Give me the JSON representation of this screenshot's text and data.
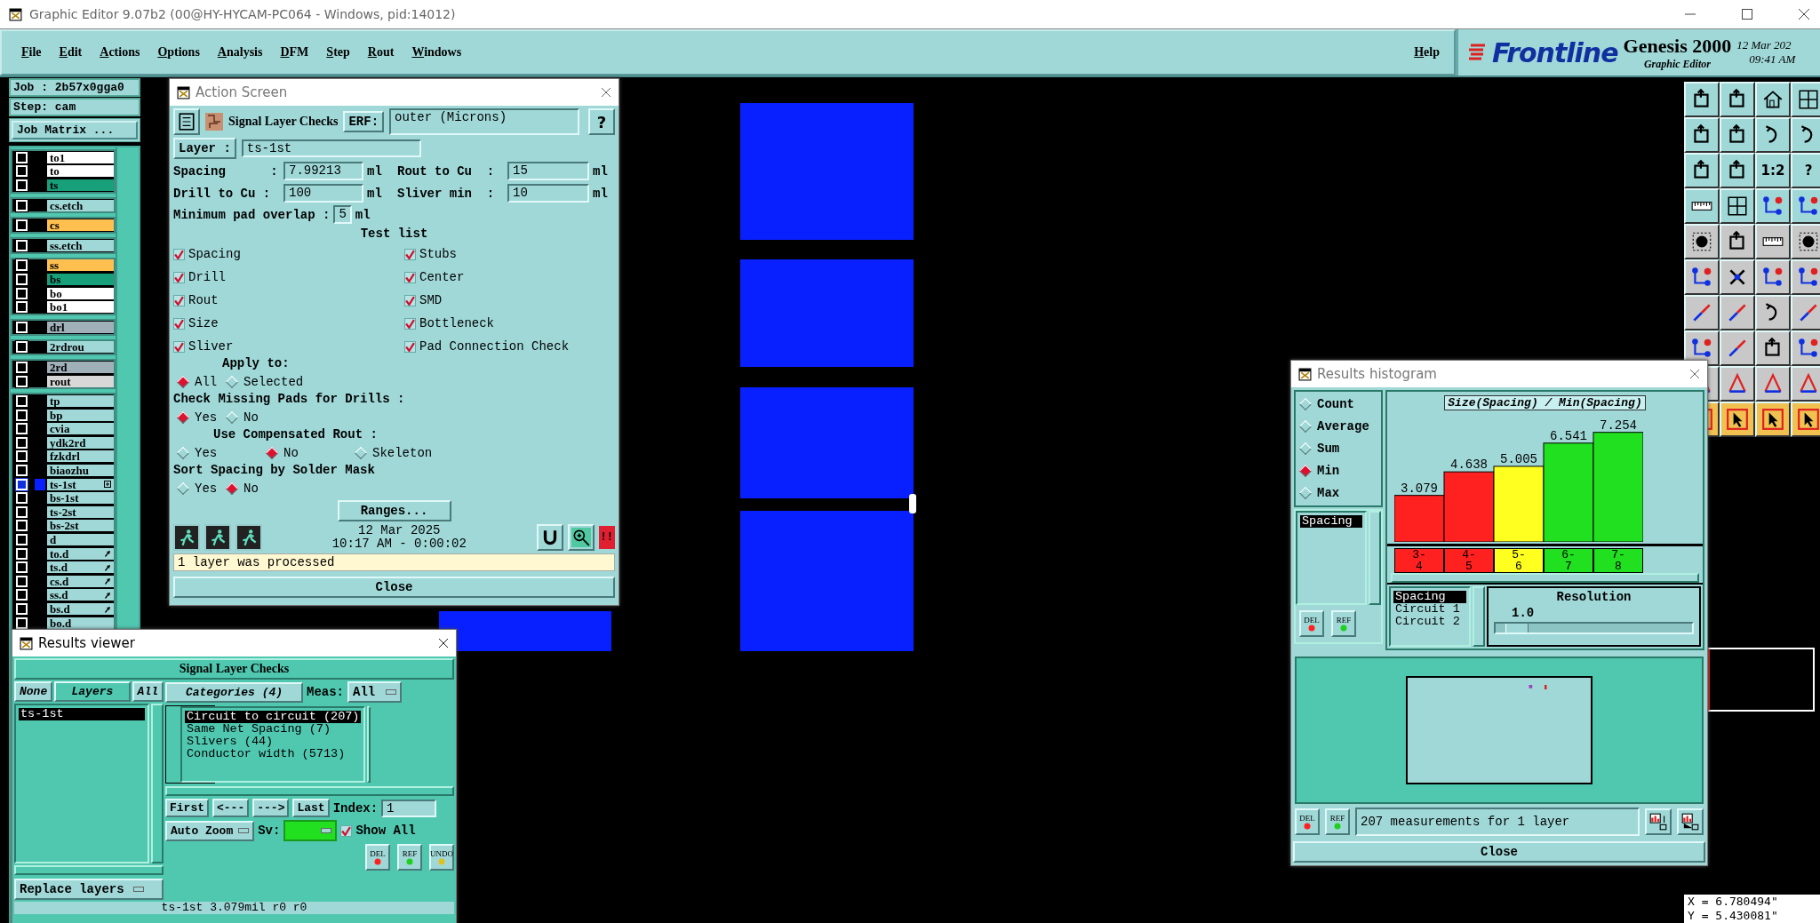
{
  "app": {
    "title": "Graphic Editor 9.07b2 (00@HY-HYCAM-PC064 - Windows, pid:14012)"
  },
  "menu": [
    "File",
    "Edit",
    "Actions",
    "Options",
    "Analysis",
    "DFM",
    "Step",
    "Rout",
    "Windows"
  ],
  "help": "Help",
  "brand": {
    "logo": "Frontline",
    "product": "Genesis 2000",
    "subtitle": "Graphic Editor",
    "date": "12 Mar 202",
    "time": "09:41 AM"
  },
  "job": {
    "job": "Job : 2b57x0gga0",
    "step": "Step: cam",
    "matrix_button": "Job Matrix ..."
  },
  "layer_groups": [
    [
      {
        "name": "to1",
        "color": "#ffffff",
        "selected": false
      },
      {
        "name": "to",
        "color": "#ffffff",
        "selected": false
      },
      {
        "name": "ts",
        "color": "#18a07a",
        "selected": false
      }
    ],
    [
      {
        "name": "cs.etch",
        "color": "#a0d8d8",
        "selected": false
      }
    ],
    [
      {
        "name": "cs",
        "color": "#ffc050",
        "selected": false
      }
    ],
    [
      {
        "name": "ss.etch",
        "color": "#a0d8d8",
        "selected": false
      }
    ],
    [
      {
        "name": "ss",
        "color": "#ffc050",
        "selected": false
      },
      {
        "name": "bs",
        "color": "#18a07a",
        "selected": false
      },
      {
        "name": "bo",
        "color": "#ffffff",
        "selected": false
      },
      {
        "name": "bo1",
        "color": "#ffffff",
        "selected": false
      }
    ],
    [
      {
        "name": "drl",
        "color": "#a0b0b8",
        "selected": false
      }
    ],
    [
      {
        "name": "2rdrou",
        "color": "#a0d8d8",
        "selected": false
      }
    ],
    [
      {
        "name": "2rd",
        "color": "#a0b0b8",
        "selected": false
      },
      {
        "name": "rout",
        "color": "#d8d8d8",
        "selected": false
      }
    ],
    [
      {
        "name": "tp",
        "color": "#a0d8d8",
        "selected": false
      },
      {
        "name": "bp",
        "color": "#a0d8d8",
        "selected": false
      },
      {
        "name": "cvia",
        "color": "#a0d8d8",
        "selected": false
      },
      {
        "name": "ydk2rd",
        "color": "#a0d8d8",
        "selected": false
      },
      {
        "name": "fzkdrl",
        "color": "#a0d8d8",
        "selected": false
      },
      {
        "name": "biaozhu",
        "color": "#a0d8d8",
        "selected": false
      },
      {
        "name": "ts-1st",
        "color": "#a0d8d8",
        "selected": true,
        "kind": "expandable"
      },
      {
        "name": "bs-1st",
        "color": "#a0d8d8",
        "selected": false
      },
      {
        "name": "ts-2st",
        "color": "#a0d8d8",
        "selected": false
      },
      {
        "name": "bs-2st",
        "color": "#a0d8d8",
        "selected": false
      },
      {
        "name": "d",
        "color": "#a0d8d8",
        "selected": false
      },
      {
        "name": "to.d",
        "color": "#a0d8d8",
        "selected": false,
        "kind": "linked"
      },
      {
        "name": "ts.d",
        "color": "#a0d8d8",
        "selected": false,
        "kind": "linked"
      },
      {
        "name": "cs.d",
        "color": "#a0d8d8",
        "selected": false,
        "kind": "linked"
      },
      {
        "name": "ss.d",
        "color": "#a0d8d8",
        "selected": false,
        "kind": "linked"
      },
      {
        "name": "bs.d",
        "color": "#a0d8d8",
        "selected": false,
        "kind": "linked"
      },
      {
        "name": "bo.d",
        "color": "#a0d8d8",
        "selected": false
      }
    ]
  ],
  "toolbar": [
    {
      "kind": "frame"
    },
    {
      "kind": "frame"
    },
    {
      "kind": "house"
    },
    {
      "kind": "grid"
    },
    {
      "kind": "frame"
    },
    {
      "kind": "frame"
    },
    {
      "kind": "curve"
    },
    {
      "kind": "curve"
    },
    {
      "kind": "frame"
    },
    {
      "kind": "frame"
    },
    {
      "kind": "label",
      "label": "1:2"
    },
    {
      "kind": "label",
      "label": "?"
    },
    {
      "kind": "ruler"
    },
    {
      "kind": "grid"
    },
    {
      "kind": "circuit"
    },
    {
      "kind": "circuit"
    },
    {
      "kind": "dot"
    },
    {
      "kind": "frame"
    },
    {
      "kind": "ruler"
    },
    {
      "kind": "dot"
    },
    {
      "kind": "circuit"
    },
    {
      "kind": "cross"
    },
    {
      "kind": "circuit"
    },
    {
      "kind": "circuit"
    },
    {
      "kind": "line"
    },
    {
      "kind": "line"
    },
    {
      "kind": "curve"
    },
    {
      "kind": "line"
    },
    {
      "kind": "circuit"
    },
    {
      "kind": "line"
    },
    {
      "kind": "frame"
    },
    {
      "kind": "circuit"
    },
    {
      "kind": "triangle"
    },
    {
      "kind": "triangle"
    },
    {
      "kind": "triangle"
    },
    {
      "kind": "triangle"
    },
    {
      "kind": "pointer"
    },
    {
      "kind": "pointer"
    },
    {
      "kind": "pointer"
    },
    {
      "kind": "pointer"
    }
  ],
  "action_screen": {
    "title": "Action Screen",
    "check_name": "Signal Layer Checks",
    "erf_label": "ERF:",
    "erf_value": "outer (Microns)",
    "help": "?",
    "layer_label": "Layer :",
    "layer_value": "ts-1st",
    "params": [
      {
        "label": "Spacing      :",
        "value": "7.99213",
        "unit": "ml"
      },
      {
        "label": "Rout to Cu  :",
        "value": "15",
        "unit": "ml"
      },
      {
        "label": "Drill to Cu :",
        "value": "100",
        "unit": "ml"
      },
      {
        "label": "Sliver min  :",
        "value": "10",
        "unit": "ml"
      }
    ],
    "overlap": {
      "label": "Minimum pad overlap :",
      "value": "5",
      "unit": "ml"
    },
    "test_title": "Test list",
    "tests": [
      {
        "label": "Spacing",
        "checked": true
      },
      {
        "label": "Stubs",
        "checked": true
      },
      {
        "label": "Drill",
        "checked": true
      },
      {
        "label": "Center",
        "checked": true
      },
      {
        "label": "Rout",
        "checked": true
      },
      {
        "label": "SMD",
        "checked": true
      },
      {
        "label": "Size",
        "checked": true
      },
      {
        "label": "Bottleneck",
        "checked": true
      },
      {
        "label": "Sliver",
        "checked": true
      },
      {
        "label": "Pad Connection Check",
        "checked": true
      }
    ],
    "radio_groups": [
      {
        "title": "Apply to:",
        "options": [
          {
            "label": "All",
            "selected": true
          },
          {
            "label": "Selected",
            "selected": false
          }
        ]
      },
      {
        "title": "Check Missing Pads for Drills :",
        "options": [
          {
            "label": "Yes",
            "selected": true
          },
          {
            "label": "No",
            "selected": false
          }
        ]
      },
      {
        "title": "Use Compensated Rout :",
        "options": [
          {
            "label": "Yes",
            "selected": false
          },
          {
            "label": "No",
            "selected": true
          },
          {
            "label": "Skeleton",
            "selected": false
          }
        ]
      },
      {
        "title": "Sort Spacing by Solder Mask",
        "options": [
          {
            "label": "Yes",
            "selected": false
          },
          {
            "label": "No",
            "selected": true
          }
        ]
      }
    ],
    "ranges_button": "Ranges...",
    "date": "12 Mar 2025",
    "time": "10:17 AM - 0:00:02",
    "alert": "!!",
    "status": "1 layer was processed",
    "close": "Close"
  },
  "results_viewer": {
    "title": "Results viewer",
    "header": "Signal Layer Checks",
    "layer_buttons": [
      "None",
      "Layers",
      "All"
    ],
    "layers": [
      {
        "name": "ts-1st",
        "selected": true
      }
    ],
    "categories_button": "Categories (4)",
    "meas_label": "Meas:",
    "meas_value": "All",
    "categories": [
      {
        "label": "Circuit to circuit (207)",
        "selected": true
      },
      {
        "label": "Same Net Spacing (7)",
        "selected": false
      },
      {
        "label": "Slivers (44)",
        "selected": false
      },
      {
        "label": "Conductor width (5713)",
        "selected": false
      }
    ],
    "nav": [
      "First",
      "<---",
      "--->",
      "Last"
    ],
    "index_label": "Index:",
    "index_value": "1",
    "auto_zoom": "Auto Zoom",
    "sv_label": "Sv:",
    "show_all": {
      "label": "Show All",
      "checked": true
    },
    "replace": "Replace layers",
    "actions": [
      "DEL",
      "REF",
      "UNDO"
    ],
    "status": "ts-1st 3.079mil  r0  r0"
  },
  "histogram": {
    "title": "Results histogram",
    "modes": [
      {
        "label": "Count",
        "selected": false
      },
      {
        "label": "Average",
        "selected": false
      },
      {
        "label": "Sum",
        "selected": false
      },
      {
        "label": "Min",
        "selected": true
      },
      {
        "label": "Max",
        "selected": false
      }
    ],
    "measures": [
      {
        "label": "Spacing",
        "selected": true
      }
    ],
    "chart_data": {
      "type": "bar",
      "title": "Size(Spacing) / Min(Spacing)",
      "categories": [
        "3-4",
        "4-5",
        "5-6",
        "6-7",
        "7-8"
      ],
      "values": [
        3.079,
        4.638,
        5.005,
        6.541,
        7.254
      ],
      "colors": [
        "#ff2020",
        "#ff2020",
        "#ffff20",
        "#20e020",
        "#20e020"
      ],
      "data_labels": true
    },
    "fields": [
      {
        "label": "Spacing",
        "selected": true
      },
      {
        "label": "Circuit 1",
        "selected": false
      },
      {
        "label": "Circuit 2",
        "selected": false
      }
    ],
    "resolution_title": "Resolution",
    "resolution_value": "1.0",
    "resolution": {
      "level": 0.05
    },
    "actions": [
      "DEL",
      "REF"
    ],
    "bottom_actions": [
      "DEL",
      "REF"
    ],
    "status": "207 measurements for 1 layer",
    "close": "Close"
  },
  "coordinates": [
    "X = 6.780494\"",
    "Y = 5.430081\""
  ]
}
